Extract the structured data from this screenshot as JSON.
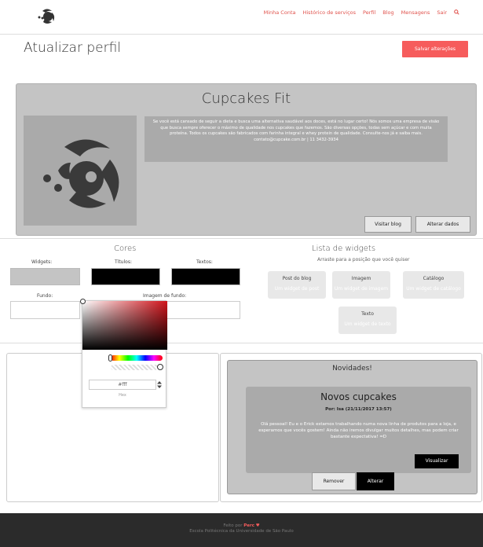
{
  "nav": {
    "links": [
      "Minha Conta",
      "Histórico de serviços",
      "Perfil",
      "Blog",
      "Mensagens",
      "Sair"
    ],
    "search_icon": "search-icon"
  },
  "page": {
    "title": "Atualizar perfil",
    "save_label": "Salvar alterações"
  },
  "hero": {
    "title": "Cupcakes Fit",
    "description": "Se você está cansado de seguir a dieta e busca uma alternativa saudável aos doces, está no lugar certo! Nós somos uma empresa de visão que busca sempre oferecer o máximo de qualidade nos cupcakes que fazemos. São diversas opções, todas sem açúcar e com muita proteína. Todos os cupcakes são fabricados com farinha integral e whey protein de qualidade. Consulte-nos já e saiba mais.",
    "contact": "contato@cupcake.com.br | 11 3432-3934",
    "visit_blog": "Visitar blog",
    "edit_data": "Alterar dados"
  },
  "colors": {
    "title": "Cores",
    "widgets_label": "Widgets:",
    "titles_label": "Títulos:",
    "texts_label": "Textos:",
    "background_label": "Fundo:",
    "bg_image_label": "Imagem de fundo:",
    "widgets_color": "#c4c4c4",
    "titles_color": "#000000",
    "texts_color": "#000000"
  },
  "picker": {
    "hex_value": "#fff",
    "hex_label": "Hex",
    "hue_color": "#d0131a"
  },
  "widgets": {
    "title": "Lista de widgets",
    "subtitle": "Arraste para a posição que você quiser",
    "items": [
      {
        "title": "Post do blog",
        "sub": "Um widget de post"
      },
      {
        "title": "Imagem",
        "sub": "Um widget de imagem"
      },
      {
        "title": "Catálogo",
        "sub": "Um widget de catálogo"
      },
      {
        "title": "Texto",
        "sub": "Um widget de texto"
      }
    ]
  },
  "news": {
    "title": "Novidades!",
    "post_title": "Novos cupcakes",
    "post_meta": "Por: Isa (21/11/2017 13:57)",
    "post_body": "Olá pessoal! Eu e o Erick estamos trabalhando numa nova linha de produtos para a loja, e esperamos que vocês gostem! Ainda não iremos divulgar muitos detalhes, mas podem criar bastante expectativa! =D",
    "view_label": "Visualizar",
    "remove_label": "Remover",
    "edit_label": "Alterar"
  },
  "footer": {
    "made_by": "Feito por",
    "author": "Perc",
    "institution": "Escola Politécnica da Universidade de São Paulo"
  }
}
